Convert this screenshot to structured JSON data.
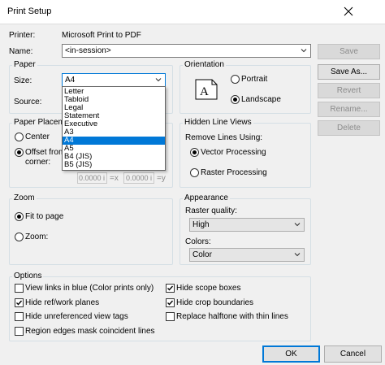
{
  "window": {
    "title": "Print Setup"
  },
  "printer": {
    "label": "Printer:",
    "value": "Microsoft Print to PDF"
  },
  "name": {
    "label": "Name:",
    "value": "<in-session>"
  },
  "side_buttons": {
    "save": "Save",
    "save_as": "Save As...",
    "revert": "Revert",
    "rename": "Rename...",
    "delete": "Delete"
  },
  "paper": {
    "title": "Paper",
    "size_label": "Size:",
    "size_value": "A4",
    "source_label": "Source:",
    "options": [
      "Letter",
      "Tabloid",
      "Legal",
      "Statement",
      "Executive",
      "A3",
      "A4",
      "A5",
      "B4 (JIS)",
      "B5 (JIS)"
    ],
    "selected_index": 6
  },
  "orientation": {
    "title": "Orientation",
    "portrait": "Portrait",
    "landscape": "Landscape",
    "icon_letter": "A"
  },
  "paper_placement": {
    "title": "Paper Placement",
    "center": "Center",
    "offset_line1": "Offset from",
    "offset_line2": "corner:",
    "x_value": "0.0000 i",
    "x_suffix": "=x",
    "y_value": "0.0000 i",
    "y_suffix": "=y"
  },
  "hidden_line": {
    "title": "Hidden Line Views",
    "remove_label": "Remove Lines Using:",
    "vector": "Vector Processing",
    "raster": "Raster Processing"
  },
  "zoom": {
    "title": "Zoom",
    "fit": "Fit to page",
    "zoom": "Zoom:"
  },
  "appearance": {
    "title": "Appearance",
    "raster_label": "Raster quality:",
    "raster_value": "High",
    "colors_label": "Colors:",
    "colors_value": "Color"
  },
  "options": {
    "title": "Options",
    "items": [
      {
        "label": "View links in blue (Color prints only)",
        "checked": false
      },
      {
        "label": "Hide ref/work planes",
        "checked": true
      },
      {
        "label": "Hide unreferenced view tags",
        "checked": false
      },
      {
        "label": "Region edges mask coincident lines",
        "checked": false
      },
      {
        "label": "Hide scope boxes",
        "checked": true
      },
      {
        "label": "Hide crop boundaries",
        "checked": true
      },
      {
        "label": "Replace halftone with thin lines",
        "checked": false
      }
    ]
  },
  "footer": {
    "ok": "OK",
    "cancel": "Cancel"
  }
}
